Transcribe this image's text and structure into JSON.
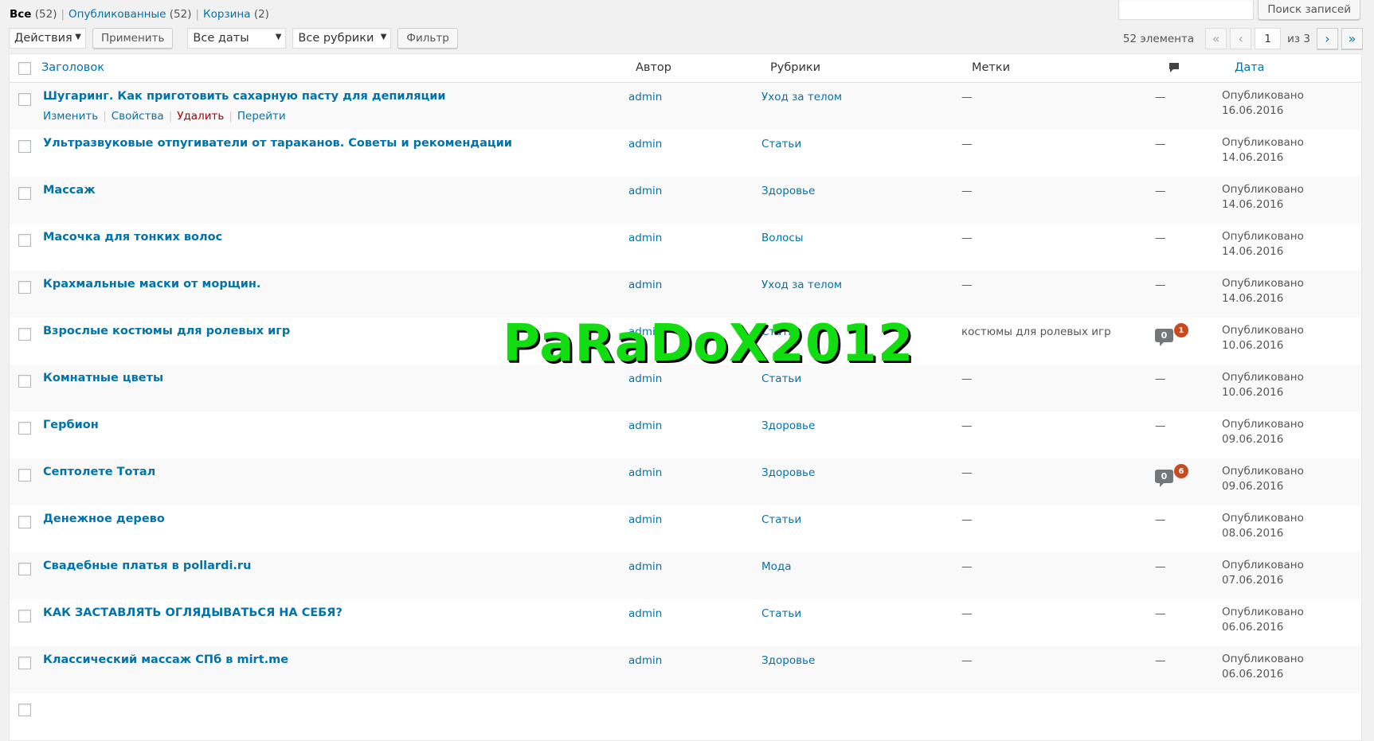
{
  "views": {
    "all_label": "Все",
    "all_count": "(52)",
    "published_label": "Опубликованные",
    "published_count": "(52)",
    "trash_label": "Корзина",
    "trash_count": "(2)",
    "separator": "|"
  },
  "search": {
    "button_label": "Поиск записей",
    "value": ""
  },
  "filters": {
    "bulk_action": "Действия",
    "apply_label": "Применить",
    "dates": "Все даты",
    "categories": "Все рубрики",
    "filter_label": "Фильтр",
    "caret": "▼"
  },
  "pagination": {
    "items_text": "52 элемента",
    "first": "«",
    "prev": "‹",
    "current_page": "1",
    "of_text": "из 3",
    "next": "›",
    "last": "»"
  },
  "table": {
    "columns": {
      "title": "Заголовок",
      "author": "Автор",
      "categories": "Рубрики",
      "tags": "Метки",
      "date": "Дата"
    },
    "row_actions": {
      "edit": "Изменить",
      "properties": "Свойства",
      "delete": "Удалить",
      "view": "Перейти",
      "sep": "|"
    },
    "rows": [
      {
        "title": "Шугаринг. Как приготовить сахарную пасту для депиляции",
        "author": "admin",
        "category": "Уход за телом",
        "tags": "—",
        "comments": "—",
        "status": "Опубликовано",
        "date": "16.06.2016"
      },
      {
        "title": "Ультразвуковые отпугиватели от тараканов. Советы и рекомендации",
        "author": "admin",
        "category": "Статьи",
        "tags": "—",
        "comments": "—",
        "status": "Опубликовано",
        "date": "14.06.2016"
      },
      {
        "title": "Массаж",
        "author": "admin",
        "category": "Здоровье",
        "tags": "—",
        "comments": "—",
        "status": "Опубликовано",
        "date": "14.06.2016"
      },
      {
        "title": "Масочка для тонких волос",
        "author": "admin",
        "category": "Волосы",
        "tags": "—",
        "comments": "—",
        "status": "Опубликовано",
        "date": "14.06.2016"
      },
      {
        "title": "Крахмальные маски от морщин.",
        "author": "admin",
        "category": "Уход за телом",
        "tags": "—",
        "comments": "—",
        "status": "Опубликовано",
        "date": "14.06.2016"
      },
      {
        "title": "Взрослые костюмы для ролевых игр",
        "author": "admin",
        "category": "Статьи",
        "tags": "костюмы для ролевых игр",
        "comments_approved": "0",
        "comments_pending": "1",
        "status": "Опубликовано",
        "date": "10.06.2016"
      },
      {
        "title": "Комнатные цветы",
        "author": "admin",
        "category": "Статьи",
        "tags": "—",
        "comments": "—",
        "status": "Опубликовано",
        "date": "10.06.2016"
      },
      {
        "title": "Гербион",
        "author": "admin",
        "category": "Здоровье",
        "tags": "—",
        "comments": "—",
        "status": "Опубликовано",
        "date": "09.06.2016"
      },
      {
        "title": "Септолете Тотал",
        "author": "admin",
        "category": "Здоровье",
        "tags": "—",
        "comments_approved": "0",
        "comments_pending": "6",
        "status": "Опубликовано",
        "date": "09.06.2016"
      },
      {
        "title": "Денежное дерево",
        "author": "admin",
        "category": "Статьи",
        "tags": "—",
        "comments": "—",
        "status": "Опубликовано",
        "date": "08.06.2016"
      },
      {
        "title": "Свадебные платья в pollardi.ru",
        "author": "admin",
        "category": "Мода",
        "tags": "—",
        "comments": "—",
        "status": "Опубликовано",
        "date": "07.06.2016"
      },
      {
        "title": "КАК ЗАСТАВЛЯТЬ ОГЛЯДЫВАТЬСЯ НА СЕБЯ?",
        "author": "admin",
        "category": "Статьи",
        "tags": "—",
        "comments": "—",
        "status": "Опубликовано",
        "date": "06.06.2016"
      },
      {
        "title": "Классический массаж СПб в mirt.me",
        "author": "admin",
        "category": "Здоровье",
        "tags": "—",
        "comments": "—",
        "status": "Опубликовано",
        "date": "06.06.2016"
      },
      {
        "title": "",
        "author": "",
        "category": "",
        "tags": "",
        "comments": "",
        "status": "",
        "date": ""
      }
    ]
  },
  "watermark": "PaRaDoX2012",
  "colors": {
    "link": "#0073aa",
    "delete": "#aa0000",
    "pending_badge": "#ca4a1f",
    "comment_bubble": "#72777c",
    "watermark": "#11dd11"
  }
}
